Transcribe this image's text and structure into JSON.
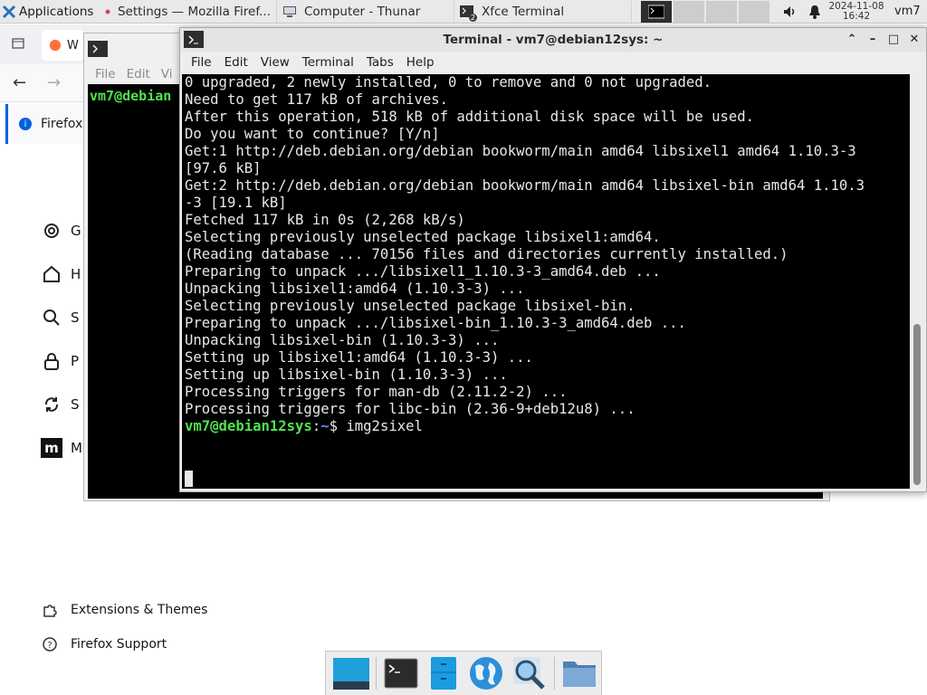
{
  "panel": {
    "applications_label": "Applications",
    "tasks": [
      {
        "label": "Settings — Mozilla Firef..."
      },
      {
        "label": "Computer - Thunar"
      },
      {
        "label": "Xfce Terminal"
      }
    ],
    "terminal_badge": "2",
    "clock_date": "2024-11-08",
    "clock_time": "16:42",
    "user": "vm7"
  },
  "firefox": {
    "tab_label": "W",
    "notice_label": "Firefox",
    "sidebar_partial": [
      "G",
      "H",
      "S",
      "P",
      "S",
      "M"
    ],
    "footer": [
      {
        "label": "Extensions & Themes",
        "icon": "puzzle-icon"
      },
      {
        "label": "Firefox Support",
        "icon": "help-icon"
      }
    ]
  },
  "bg_terminal": {
    "menu": [
      "File",
      "Edit",
      "Vi"
    ],
    "prompt": "vm7@debian"
  },
  "terminal": {
    "title": "Terminal - vm7@debian12sys: ~",
    "menu": [
      "File",
      "Edit",
      "View",
      "Terminal",
      "Tabs",
      "Help"
    ],
    "lines": [
      "0 upgraded, 2 newly installed, 0 to remove and 0 not upgraded.",
      "Need to get 117 kB of archives.",
      "After this operation, 518 kB of additional disk space will be used.",
      "Do you want to continue? [Y/n]",
      "Get:1 http://deb.debian.org/debian bookworm/main amd64 libsixel1 amd64 1.10.3-3",
      "[97.6 kB]",
      "Get:2 http://deb.debian.org/debian bookworm/main amd64 libsixel-bin amd64 1.10.3",
      "-3 [19.1 kB]",
      "Fetched 117 kB in 0s (2,268 kB/s)",
      "Selecting previously unselected package libsixel1:amd64.",
      "(Reading database ... 70156 files and directories currently installed.)",
      "Preparing to unpack .../libsixel1_1.10.3-3_amd64.deb ...",
      "Unpacking libsixel1:amd64 (1.10.3-3) ...",
      "Selecting previously unselected package libsixel-bin.",
      "Preparing to unpack .../libsixel-bin_1.10.3-3_amd64.deb ...",
      "Unpacking libsixel-bin (1.10.3-3) ...",
      "Setting up libsixel1:amd64 (1.10.3-3) ...",
      "Setting up libsixel-bin (1.10.3-3) ...",
      "Processing triggers for man-db (2.11.2-2) ...",
      "Processing triggers for libc-bin (2.36-9+deb12u8) ..."
    ],
    "prompt_user": "vm7@debian12sys",
    "prompt_sep": ":",
    "prompt_path": "~",
    "prompt_symbol": "$ ",
    "command": "img2sixel"
  },
  "dock": [
    "desktop-icon",
    "terminal-icon",
    "file-manager-icon",
    "web-browser-icon",
    "app-finder-icon",
    "folder-icon"
  ]
}
